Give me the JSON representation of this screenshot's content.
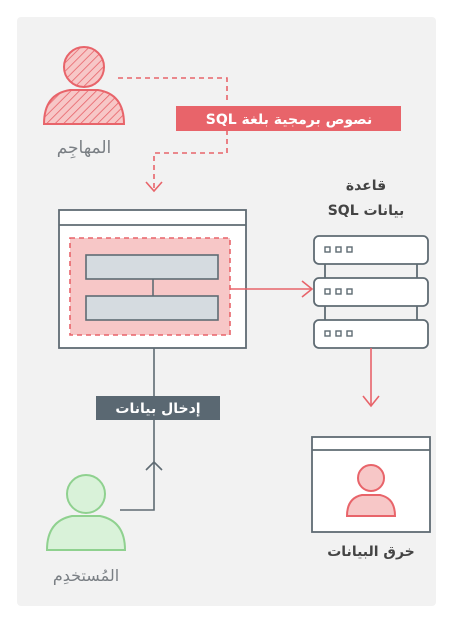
{
  "attacker": {
    "label": "المهاجِم"
  },
  "sql_injection": {
    "label": "نصوص برمجية بلغة SQL"
  },
  "database": {
    "title_line1": "قاعدة",
    "title_line2": "بيانات SQL"
  },
  "data_entry": {
    "label": "إدخال بيانات"
  },
  "user": {
    "label": "المُستخدِم"
  },
  "breach": {
    "label": "خرق البيانات"
  },
  "colors": {
    "attacker_red": "#e8646a",
    "attacker_fill": "#f7c7c7",
    "user_green": "#8fd18f",
    "user_fill": "#d9f2d9",
    "label_dark": "#5a6872",
    "line_gray": "#5f6b73",
    "form_bar": "#d5dbe0"
  }
}
